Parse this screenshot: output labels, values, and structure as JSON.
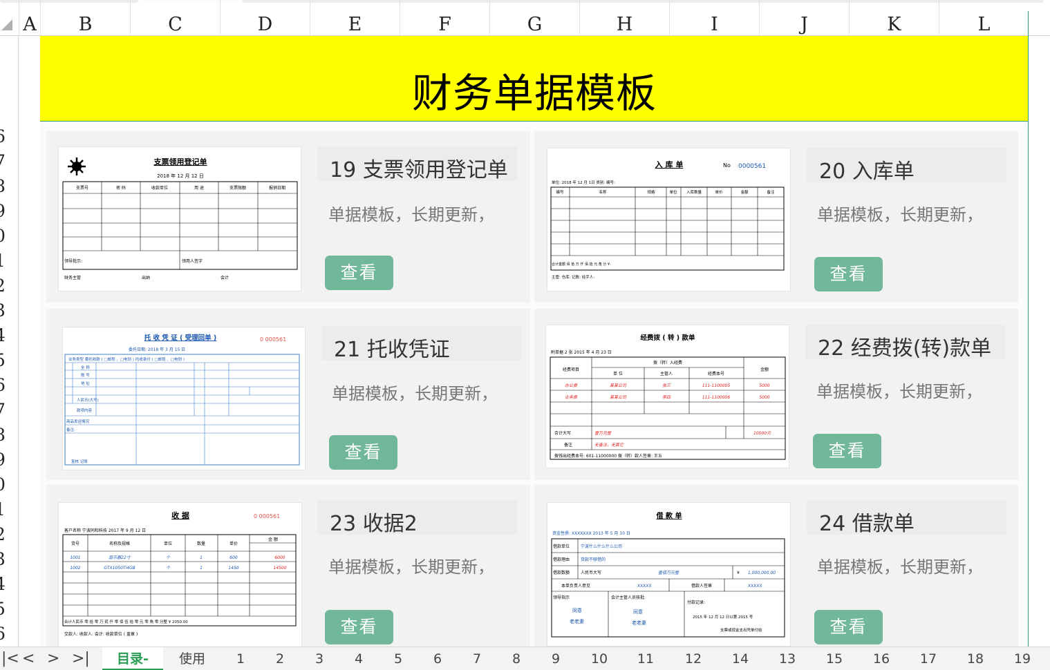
{
  "columns": [
    "A",
    "B",
    "C",
    "D",
    "E",
    "F",
    "G",
    "H",
    "I",
    "J",
    "K",
    "L"
  ],
  "rows": [
    "6",
    "7",
    "8",
    "9",
    "0",
    "1",
    "2",
    "3",
    "4",
    "5",
    "6",
    "7",
    "8",
    "9",
    "0",
    "1",
    "2",
    "3",
    "4",
    "5",
    "6"
  ],
  "banner": {
    "title": "财务单据模板"
  },
  "cards": [
    {
      "title": "19 支票领用登记单",
      "desc": "单据模板，长期更新，",
      "button": "查看"
    },
    {
      "title": "20 入库单",
      "desc": "单据模板，长期更新，",
      "button": "查看"
    },
    {
      "title": "21 托收凭证",
      "desc": "单据模板，长期更新，",
      "button": "查看"
    },
    {
      "title": "22 经费拨(转)款单",
      "desc": "单据模板，长期更新，",
      "button": "查看"
    },
    {
      "title": "23 收据2",
      "desc": "单据模板，长期更新，",
      "button": "查看"
    },
    {
      "title": "24 借款单",
      "desc": "单据模板，长期更新，",
      "button": "查看"
    }
  ],
  "thumbs": {
    "t19": {
      "title": "支票领用登记单",
      "date": "2018 年 12 月 12 日",
      "cols": [
        "支票号",
        "密 码",
        "收款单位",
        "用 途",
        "支票限额",
        "报销日期"
      ],
      "f1": "领导批示:",
      "f2": "领用人签字",
      "s1": "财务主管",
      "s2": "出纳",
      "s3": "会计"
    },
    "t20": {
      "title": "入 库 单",
      "no_label": "No",
      "no": "0000561",
      "sub": "单位:              2018 年  12  月  1日  类别:            编号:",
      "cols": [
        "编号",
        "名称",
        "规格",
        "单位",
        "入库数量",
        "单价",
        "金额",
        "备注"
      ],
      "total": "合计金额     佰      拾      万      仟      佰      拾      元      角      分 ¥:",
      "foot": "主管:                 仓库:                    记账:                         经手人:"
    },
    "t21": {
      "title": "托 收 凭 证 ( 受理回单 )",
      "no": "0 000561",
      "date": "委托日期:   2018  年   3   月   15  日",
      "r1": "业务类型      委托收款 ( □邮划 、□电划 )           托收承付 ( □邮划 、□电划 )",
      "r2": "全 称",
      "r3": "账 号",
      "r4": "地 址",
      "r5": "人民币(大写)",
      "r6": "款项内容",
      "r7": "商品发运情况",
      "r8": "备注:",
      "r9": "复核          记账"
    },
    "t22": {
      "title": "经费拨 ( 转 ) 款单",
      "sub": "附单据    2  张                2015  年    4   月    23   日",
      "h1": "经费项目",
      "h2": "拨（转）入经费",
      "h3": "金额",
      "c1": "单 位",
      "c2": "主管人",
      "c3": "经费本号",
      "rows": [
        [
          "办公费",
          "某某公司",
          "张三",
          "111-1100005",
          "5000"
        ],
        [
          "业务费",
          "某某公司",
          "李四",
          "111-1100006",
          "5000"
        ]
      ],
      "total_label": "合计大写",
      "total": "壹万元整",
      "total_num": "10000元",
      "note_label": "备注",
      "note": "无备注，无其它",
      "foot": "拨钱出经费本号:        601-11000000          拨（转）款人签章:    王五"
    },
    "t23": {
      "title": "收  据",
      "no": "0 000561",
      "sub": "客户名称      宁波同和科技          2017  年    9    月    12    日",
      "cols": [
        "货号",
        "名称及规格",
        "单位",
        "数量",
        "单价",
        "金 额"
      ],
      "rows": [
        [
          "1001",
          "显示器22寸",
          "个",
          "1",
          "600",
          "6000"
        ],
        [
          "1002",
          "GTX1050Ti4GB",
          "个",
          "1",
          "1450",
          "14500"
        ]
      ],
      "total": "合计人民币  零 拾 零 万 贰 仟 零 佰 伍 拾 零 元 零 角 零 分整 ¥  2050.00",
      "foot": "交款人:              收款人:              会计:              收款单位 ( 盖章 )"
    },
    "t24": {
      "title": "借  款  单",
      "sub": "资金性质:  XXXXXXX                                         2013   年    5   月   10   日",
      "r1": "借款单位",
      "v1": "宁波什么什么什么公司",
      "r2": "借款理由",
      "v2": "货款不够借的",
      "r3": "借款数额",
      "v3": "人民币大写",
      "v3b": "壹佰万元整",
      "v3c": "¥",
      "v3d": "1,000,000.00",
      "r4": "本单负责人意见",
      "v4": "XXXXX",
      "r4b": "借款人签章",
      "v4b": "XXXXX",
      "r5": "领导指示",
      "r5b": "会计主管人员核批:",
      "r5c": "付款记录:",
      "v5": "同意",
      "v5b": "老老妻",
      "v6": "同意",
      "v6b": "老老妻",
      "pay": "2015   年  12  月  12   日以第   2015   号",
      "pay2": "支票或现金支出凭单付给"
    }
  },
  "tabs": {
    "nav": [
      "|<",
      "<",
      ">",
      ">|"
    ],
    "items": [
      "目录-",
      "使用",
      "1",
      "2",
      "3",
      "4",
      "5",
      "6",
      "7",
      "8",
      "9",
      "10",
      "11",
      "12",
      "14",
      "13",
      "15",
      "16",
      "17",
      "18",
      "19"
    ],
    "active": "目录-"
  },
  "colors": {
    "banner": "#ffff00",
    "button": "#71b79a",
    "active_tab": "#2a9d55"
  }
}
